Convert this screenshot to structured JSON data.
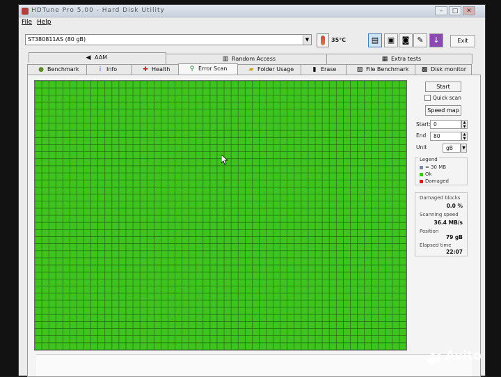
{
  "window": {
    "title": "HDTune Pro 5.00 - Hard Disk Utility"
  },
  "menu": {
    "file": "File",
    "help": "Help"
  },
  "drive": {
    "selected": "ST380811AS (80 gB)"
  },
  "temperature": "35°C",
  "toolbar": {
    "exit_label": "Exit"
  },
  "tabs_top": [
    {
      "label": "AAM",
      "icon": "speaker-icon"
    },
    {
      "label": "Random Access",
      "icon": "random-access-icon"
    },
    {
      "label": "Extra tests",
      "icon": "extra-tests-icon"
    }
  ],
  "tabs_bottom": [
    {
      "label": "Benchmark",
      "icon": "benchmark-icon"
    },
    {
      "label": "Info",
      "icon": "info-icon"
    },
    {
      "label": "Health",
      "icon": "health-icon"
    },
    {
      "label": "Error Scan",
      "icon": "magnifier-icon"
    },
    {
      "label": "Folder Usage",
      "icon": "folder-icon"
    },
    {
      "label": "Erase",
      "icon": "trash-icon"
    },
    {
      "label": "File Benchmark",
      "icon": "file-benchmark-icon"
    },
    {
      "label": "Disk monitor",
      "icon": "disk-monitor-icon"
    }
  ],
  "active_tab": "Error Scan",
  "scan": {
    "start_button": "Start",
    "quick_scan_label": "Quick scan",
    "quick_scan_checked": false,
    "speed_map_button": "Speed map",
    "start_label": "Start:",
    "start_value": "0",
    "end_label": "End",
    "end_value": "80",
    "unit_label": "Unit",
    "unit_value": "gB"
  },
  "legend": {
    "title": "Legend",
    "items": [
      {
        "label": "= 30 MB",
        "color": "#7a8aa0"
      },
      {
        "label": "Ok",
        "color": "#3fc41f"
      },
      {
        "label": "Damaged",
        "color": "#d02020"
      }
    ]
  },
  "stats": {
    "damaged_blocks_label": "Damaged blocks",
    "damaged_blocks_value": "0.0 %",
    "scanning_speed_label": "Scanning speed",
    "scanning_speed_value": "36.4 MB/s",
    "position_label": "Position",
    "position_value": "79 gB",
    "elapsed_label": "Elapsed time",
    "elapsed_value": "22:07"
  },
  "block_map": {
    "status": "all-ok",
    "ok_color": "#3fc41f",
    "grid_color": "#1f6a12"
  },
  "watermark": "Avito"
}
